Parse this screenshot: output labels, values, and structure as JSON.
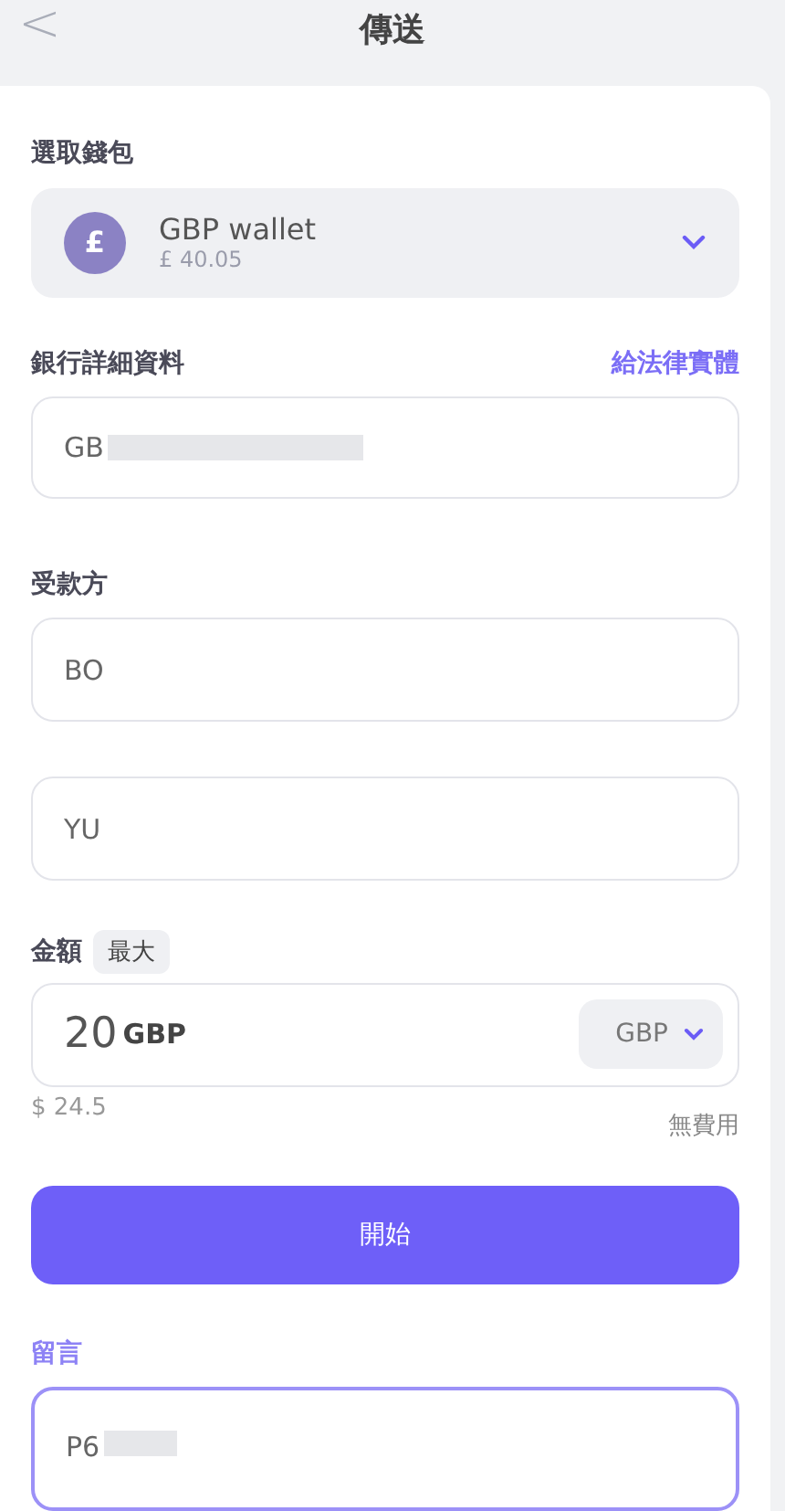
{
  "header": {
    "back": "<",
    "title": "傳送"
  },
  "wallet": {
    "label": "選取錢包",
    "symbol": "£",
    "name": "GBP wallet",
    "balance": "£ 40.05"
  },
  "bank": {
    "label": "銀行詳細資料",
    "link": "給法律實體",
    "value": "GB",
    "redacted": true
  },
  "payee": {
    "label": "受款方",
    "fields": [
      {
        "value": "BO"
      },
      {
        "value": "YU"
      }
    ]
  },
  "amount": {
    "label": "金額",
    "max": "最大",
    "value": "20",
    "unit": "GBP",
    "currency": "GBP",
    "converted": "$ 24.5",
    "fee": "無費用"
  },
  "start_button": "開始",
  "note": {
    "label": "留言",
    "value": "P6",
    "redacted": true,
    "focused": true
  }
}
